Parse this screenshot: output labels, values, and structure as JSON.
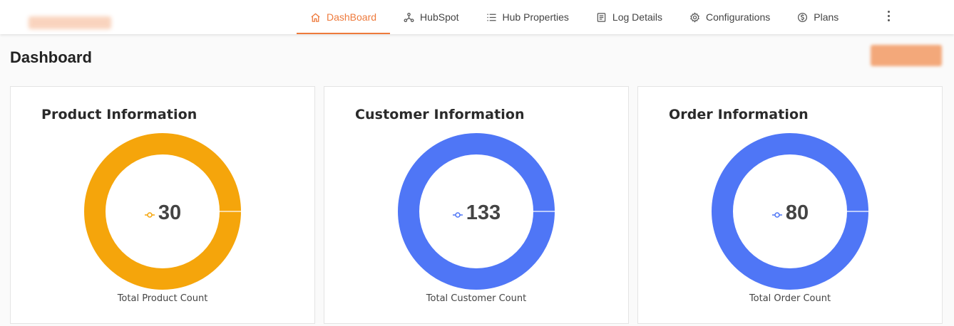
{
  "nav": {
    "items": [
      {
        "label": "DashBoard",
        "icon": "home-icon",
        "active": true
      },
      {
        "label": "HubSpot",
        "icon": "hubspot-icon",
        "active": false
      },
      {
        "label": "Hub Properties",
        "icon": "list-icon",
        "active": false
      },
      {
        "label": "Log Details",
        "icon": "document-icon",
        "active": false
      },
      {
        "label": "Configurations",
        "icon": "gear-icon",
        "active": false
      },
      {
        "label": "Plans",
        "icon": "dollar-icon",
        "active": false
      }
    ],
    "more_icon": "vertical-dots-icon"
  },
  "page": {
    "title": "Dashboard"
  },
  "colors": {
    "accent": "#ee7a3c",
    "product": "#f5a50b",
    "customer": "#4f76f6",
    "order": "#4f76f6"
  },
  "cards": [
    {
      "title": "Product Information",
      "value": "30",
      "caption": "Total Product Count",
      "color": "#f5a50b"
    },
    {
      "title": "Customer Information",
      "value": "133",
      "caption": "Total Customer Count",
      "color": "#4f76f6"
    },
    {
      "title": "Order Information",
      "value": "80",
      "caption": "Total Order Count",
      "color": "#4f76f6"
    }
  ],
  "chart_data": [
    {
      "type": "pie",
      "title": "Product Information",
      "series": [
        {
          "values": [
            30
          ]
        }
      ],
      "xlabel": "Total Product Count"
    },
    {
      "type": "pie",
      "title": "Customer Information",
      "series": [
        {
          "values": [
            133
          ]
        }
      ],
      "xlabel": "Total Customer Count"
    },
    {
      "type": "pie",
      "title": "Order Information",
      "series": [
        {
          "values": [
            80
          ]
        }
      ],
      "xlabel": "Total Order Count"
    }
  ]
}
